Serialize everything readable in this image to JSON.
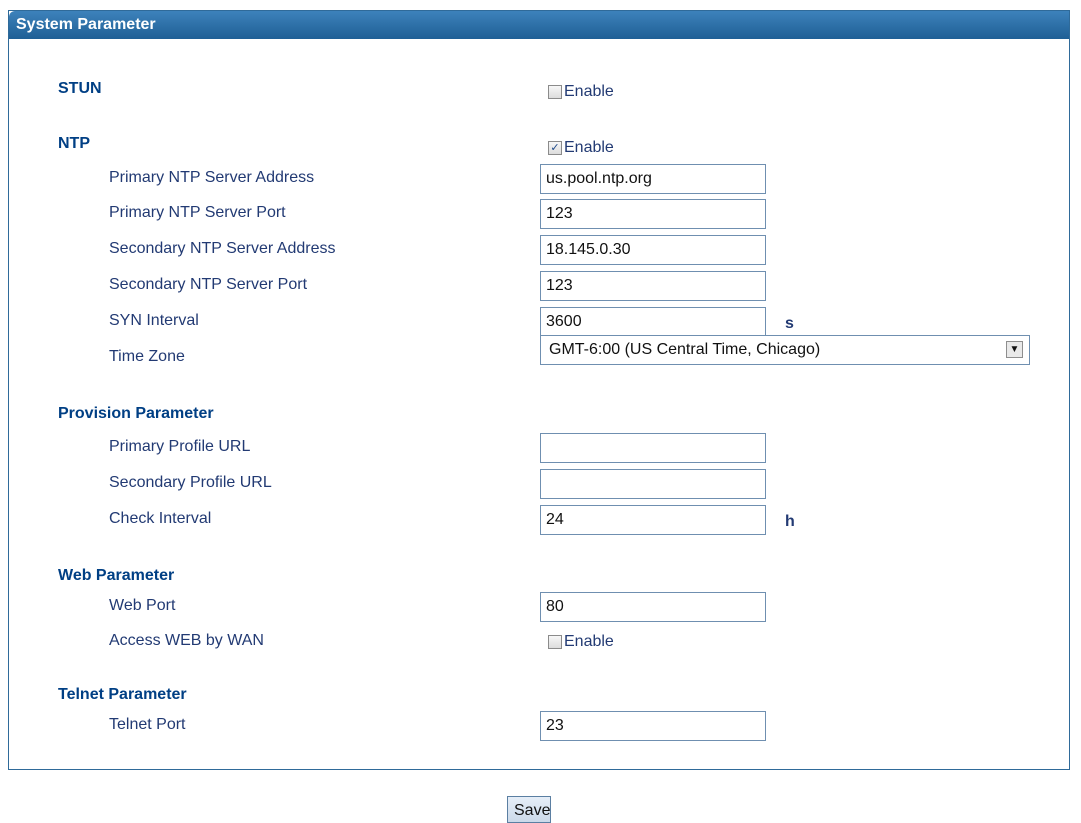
{
  "panel": {
    "title": "System Parameter"
  },
  "stun": {
    "section": "STUN",
    "enable_label": "Enable",
    "enabled": false
  },
  "ntp": {
    "section": "NTP",
    "enable_label": "Enable",
    "enabled": true,
    "primary_address_label": "Primary NTP Server Address",
    "primary_address_value": "us.pool.ntp.org",
    "primary_port_label": "Primary NTP Server Port",
    "primary_port_value": "123",
    "secondary_address_label": "Secondary NTP Server Address",
    "secondary_address_value": "18.145.0.30",
    "secondary_port_label": "Secondary NTP Server Port",
    "secondary_port_value": "123",
    "syn_interval_label": "SYN Interval",
    "syn_interval_value": "3600",
    "syn_interval_unit": "s",
    "time_zone_label": "Time Zone",
    "time_zone_value": "GMT-6:00 (US Central Time, Chicago)"
  },
  "provision": {
    "section": "Provision Parameter",
    "primary_url_label": "Primary Profile URL",
    "primary_url_value": "",
    "secondary_url_label": "Secondary Profile URL",
    "secondary_url_value": "",
    "check_interval_label": "Check Interval",
    "check_interval_value": "24",
    "check_interval_unit": "h"
  },
  "web": {
    "section": "Web Parameter",
    "port_label": "Web Port",
    "port_value": "80",
    "access_wan_label": "Access WEB by WAN",
    "access_wan_enable_label": "Enable",
    "access_wan_enabled": false
  },
  "telnet": {
    "section": "Telnet Parameter",
    "port_label": "Telnet Port",
    "port_value": "23"
  },
  "actions": {
    "save_label": "Save"
  },
  "icons": {
    "checkmark": "checkmark-icon",
    "dropdown": "chevron-down-icon"
  }
}
